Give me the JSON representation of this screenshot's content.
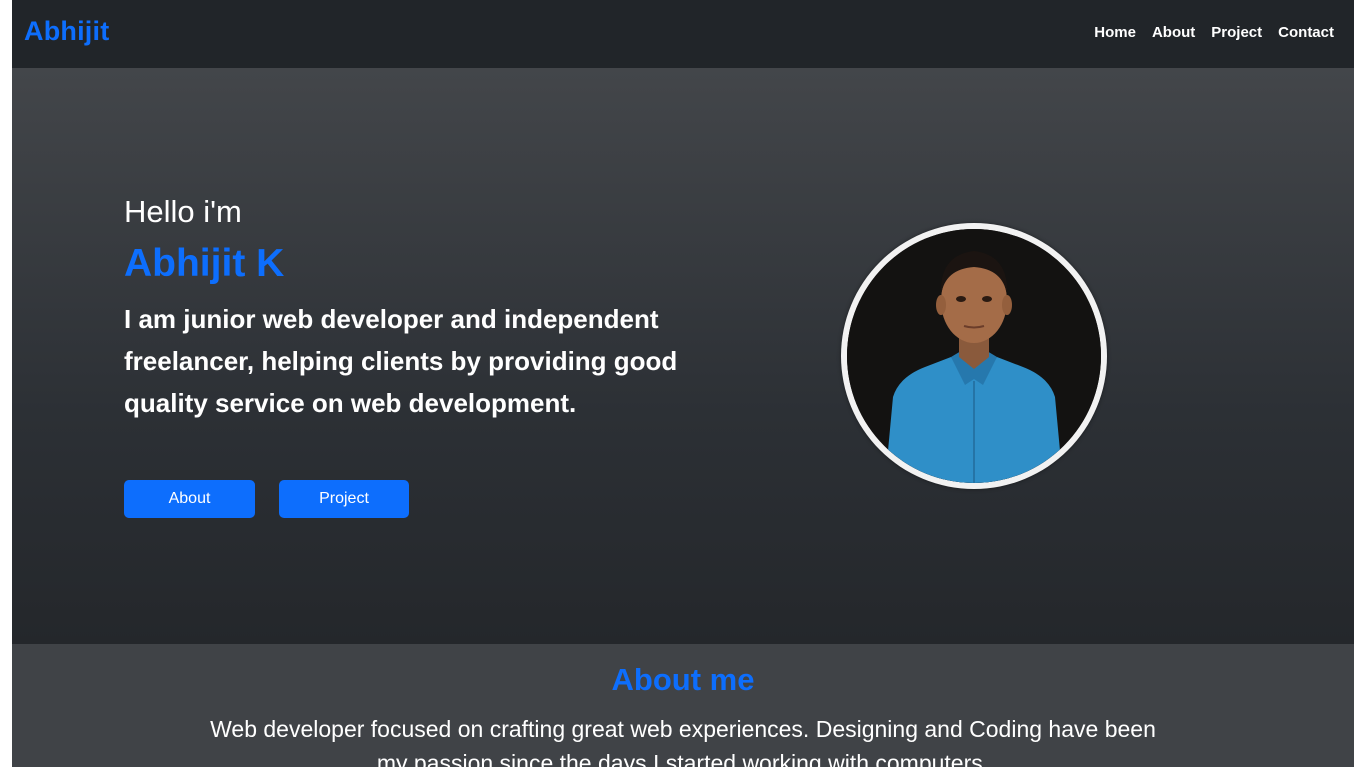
{
  "navbar": {
    "brand": "Abhijit",
    "links": [
      "Home",
      "About",
      "Project",
      "Contact"
    ]
  },
  "hero": {
    "greeting": "Hello i'm",
    "name": "Abhijit K",
    "tagline": "I am junior web developer and independent freelancer, helping clients by providing good quality service on web development.",
    "buttons": {
      "about": "About",
      "project": "Project"
    }
  },
  "about": {
    "title": "About me",
    "text": "Web developer focused on crafting great web experiences. Designing and Coding have been my passion since the days I started working with computers."
  },
  "colors": {
    "accent": "#0d6efd",
    "navbar_bg": "#212529",
    "shirt": "#2f8fc8"
  }
}
